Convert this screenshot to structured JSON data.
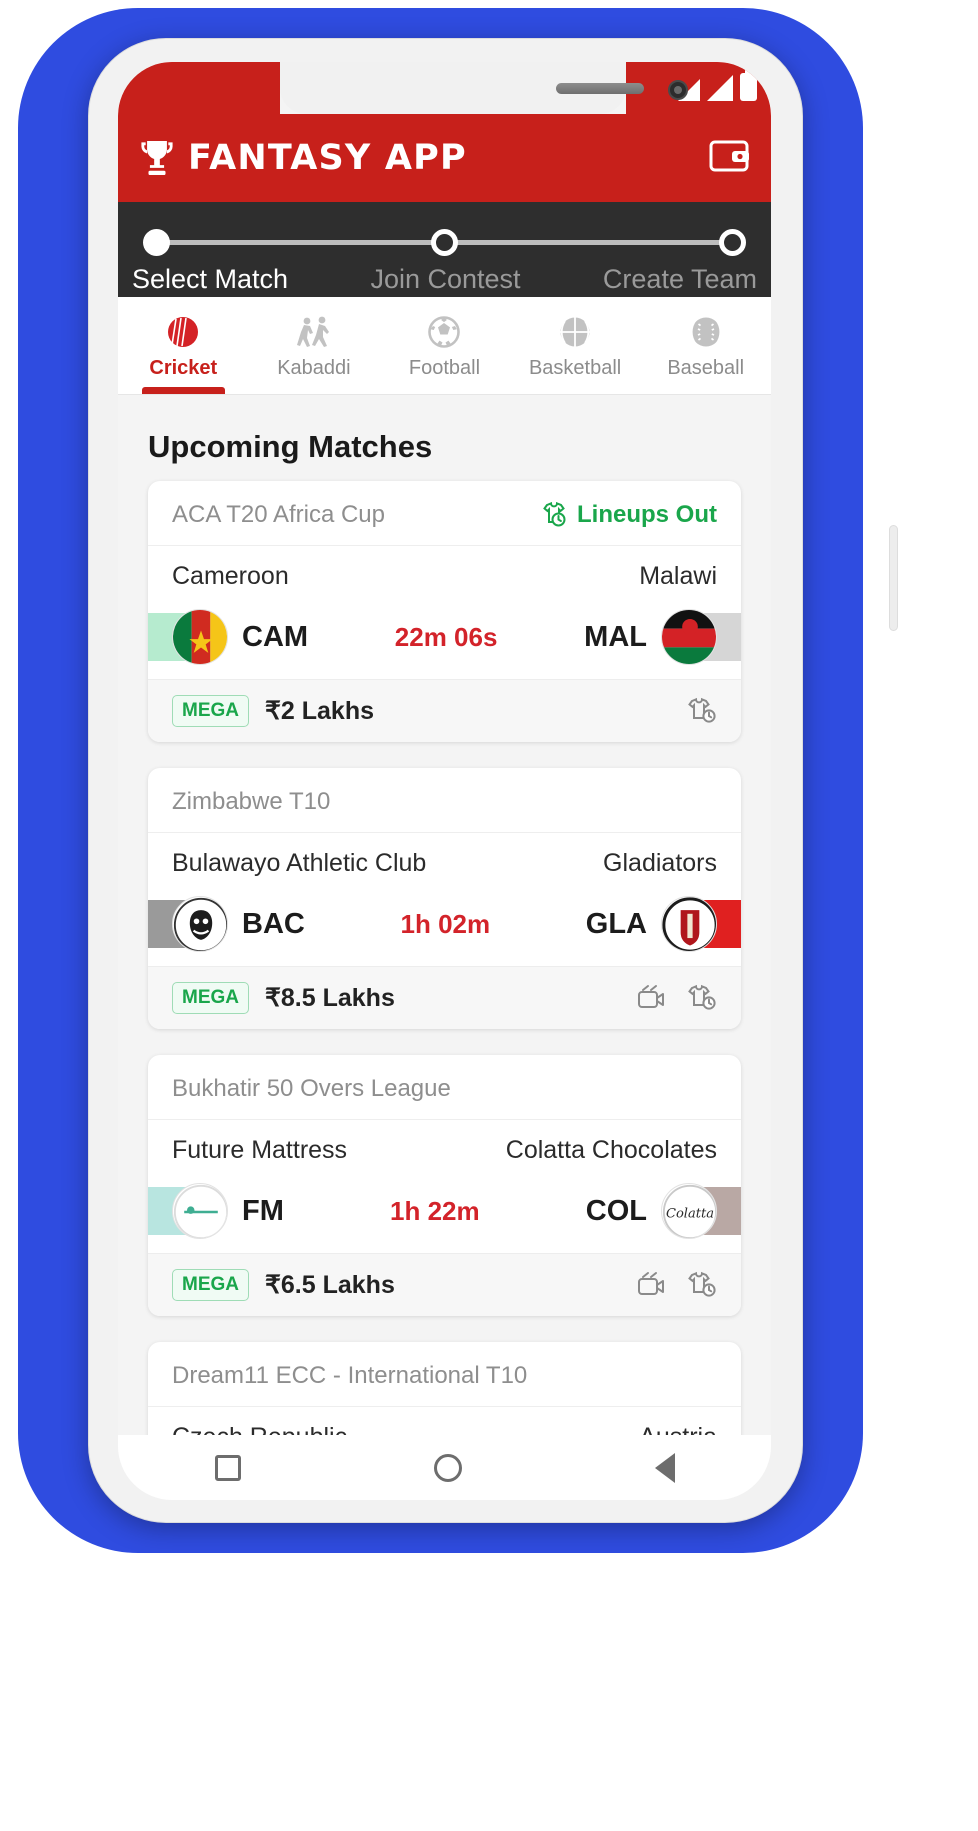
{
  "app": {
    "brand_title": "FANTASY APP",
    "trophy_icon": "trophy-icon",
    "wallet_icon": "wallet-icon",
    "header_color": "#c7201b"
  },
  "statusbar": {
    "signal_icon": "signal-bars-icon",
    "battery_icon": "battery-icon"
  },
  "stepper": {
    "steps": [
      {
        "label": "Select Match",
        "state": "active"
      },
      {
        "label": "Join Contest",
        "state": "inactive"
      },
      {
        "label": "Create Team",
        "state": "inactive"
      }
    ]
  },
  "sports_tabs": {
    "active_index": 0,
    "items": [
      {
        "label": "Cricket",
        "icon": "cricket-ball-icon"
      },
      {
        "label": "Kabaddi",
        "icon": "kabaddi-players-icon"
      },
      {
        "label": "Football",
        "icon": "football-icon"
      },
      {
        "label": "Basketball",
        "icon": "basketball-icon"
      },
      {
        "label": "Baseball",
        "icon": "baseball-icon"
      }
    ]
  },
  "main": {
    "section_title": "Upcoming Matches",
    "matches": [
      {
        "league": "ACA T20 Africa Cup",
        "lineups_label": "Lineups Out",
        "lineups_icon": "jersey-clock-icon",
        "team_left_name": "Cameroon",
        "team_left_abbr": "CAM",
        "team_right_name": "Malawi",
        "team_right_abbr": "MAL",
        "timer": "22m 06s",
        "mega_label": "MEGA",
        "prize": "₹2 Lakhs",
        "has_video_icon": false,
        "teamcard_icon": "team-card-icon",
        "strip_left_color": "#b6ebcf",
        "strip_right_color": "#d6d6d6"
      },
      {
        "league": "Zimbabwe T10",
        "lineups_label": "",
        "lineups_icon": "",
        "team_left_name": "Bulawayo Athletic Club",
        "team_left_abbr": "BAC",
        "team_right_name": "Gladiators",
        "team_right_abbr": "GLA",
        "timer": "1h 02m",
        "mega_label": "MEGA",
        "prize": "₹8.5 Lakhs",
        "has_video_icon": true,
        "video_icon": "live-video-icon",
        "teamcard_icon": "team-card-icon",
        "strip_left_color": "#9a9a9a",
        "strip_right_color": "#e02020"
      },
      {
        "league": "Bukhatir 50 Overs League",
        "lineups_label": "",
        "lineups_icon": "",
        "team_left_name": "Future Mattress",
        "team_left_abbr": "FM",
        "team_right_name": "Colatta Chocolates",
        "team_right_abbr": "COL",
        "timer": "1h 22m",
        "mega_label": "MEGA",
        "prize": "₹6.5 Lakhs",
        "has_video_icon": true,
        "video_icon": "live-video-icon",
        "teamcard_icon": "team-card-icon",
        "strip_left_color": "#b8e5e0",
        "strip_right_color": "#b9a8a4"
      },
      {
        "league": "Dream11 ECC - International T10",
        "lineups_label": "",
        "lineups_icon": "",
        "team_left_name": "Czech Republic",
        "team_left_abbr": "",
        "team_right_name": "Austria",
        "team_right_abbr": "",
        "timer": "",
        "mega_label": "",
        "prize": "",
        "has_video_icon": false,
        "teamcard_icon": "",
        "strip_left_color": "",
        "strip_right_color": ""
      }
    ]
  },
  "navbar": {
    "recents_icon": "square-recents-icon",
    "home_icon": "circle-home-icon",
    "back_icon": "triangle-back-icon"
  }
}
